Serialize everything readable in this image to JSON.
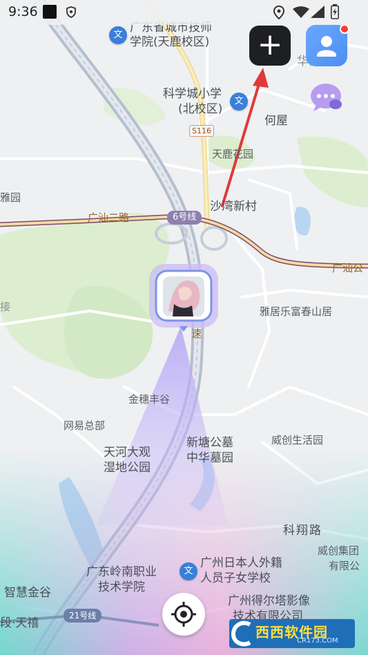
{
  "status_bar": {
    "time": "9:36"
  },
  "toolbar": {
    "add_symbol": "+"
  },
  "map_labels": {
    "poi_school_top_line1": "广东省城市技师",
    "poi_school_top_line2": "学院(天鹿校区)",
    "kexuecheng_line1": "科学城小学",
    "kexuecheng_line2": "(北校区)",
    "hewu": "何屋",
    "tianlu": "天鹿花园",
    "shawan": "沙湾新村",
    "yayuan_left": "雅园",
    "road_guangshan": "广汕二路",
    "road_guangshan_right": "广汕公",
    "metro_6": "6号线",
    "road_s116": "S116",
    "top_right_partial": "华南湖御",
    "yaju": "雅居乐富春山居",
    "speed_text": "速",
    "jinsui": "金穗丰谷",
    "netease": "网易总部",
    "weichuang": "威创生活园",
    "tianhe_line1": "天河大观",
    "tianhe_line2": "湿地公园",
    "xintang_line1": "新塘公墓",
    "xintang_line2": "中华墓园",
    "kexiang": "科翔路",
    "weichuang_group_line1": "威创集团",
    "weichuang_group_line2": "有限公",
    "japanese_school_line1": "广州日本人外籍",
    "japanese_school_line2": "人员子女学校",
    "lingnan_line1": "广东岭南职业",
    "lingnan_line2": "技术学院",
    "zhihui": "智慧金谷",
    "deerta_line1": "广州得尔塔影像",
    "deerta_line2": "技术有限公司",
    "metro_21": "21号线",
    "tianjing_partial": "段·天禧",
    "poi_badge_symbol": "文",
    "left_partial": "接"
  },
  "watermark": {
    "title": "西西软件园",
    "subtitle": "CR173.COM"
  },
  "icons": {
    "add": "plus-icon",
    "profile": "user-icon",
    "chat": "chat-bubble-icon",
    "locate": "crosshair-icon",
    "location": "location-pin-icon",
    "wifi": "wifi-icon",
    "signal": "signal-icon",
    "battery": "battery-icon"
  },
  "colors": {
    "accent": "#4d8ef2",
    "dark_button": "#1e1f22",
    "arrow": "#e03a3a",
    "road_main": "#7a4a6b",
    "expressway": "#b8c3d4"
  }
}
